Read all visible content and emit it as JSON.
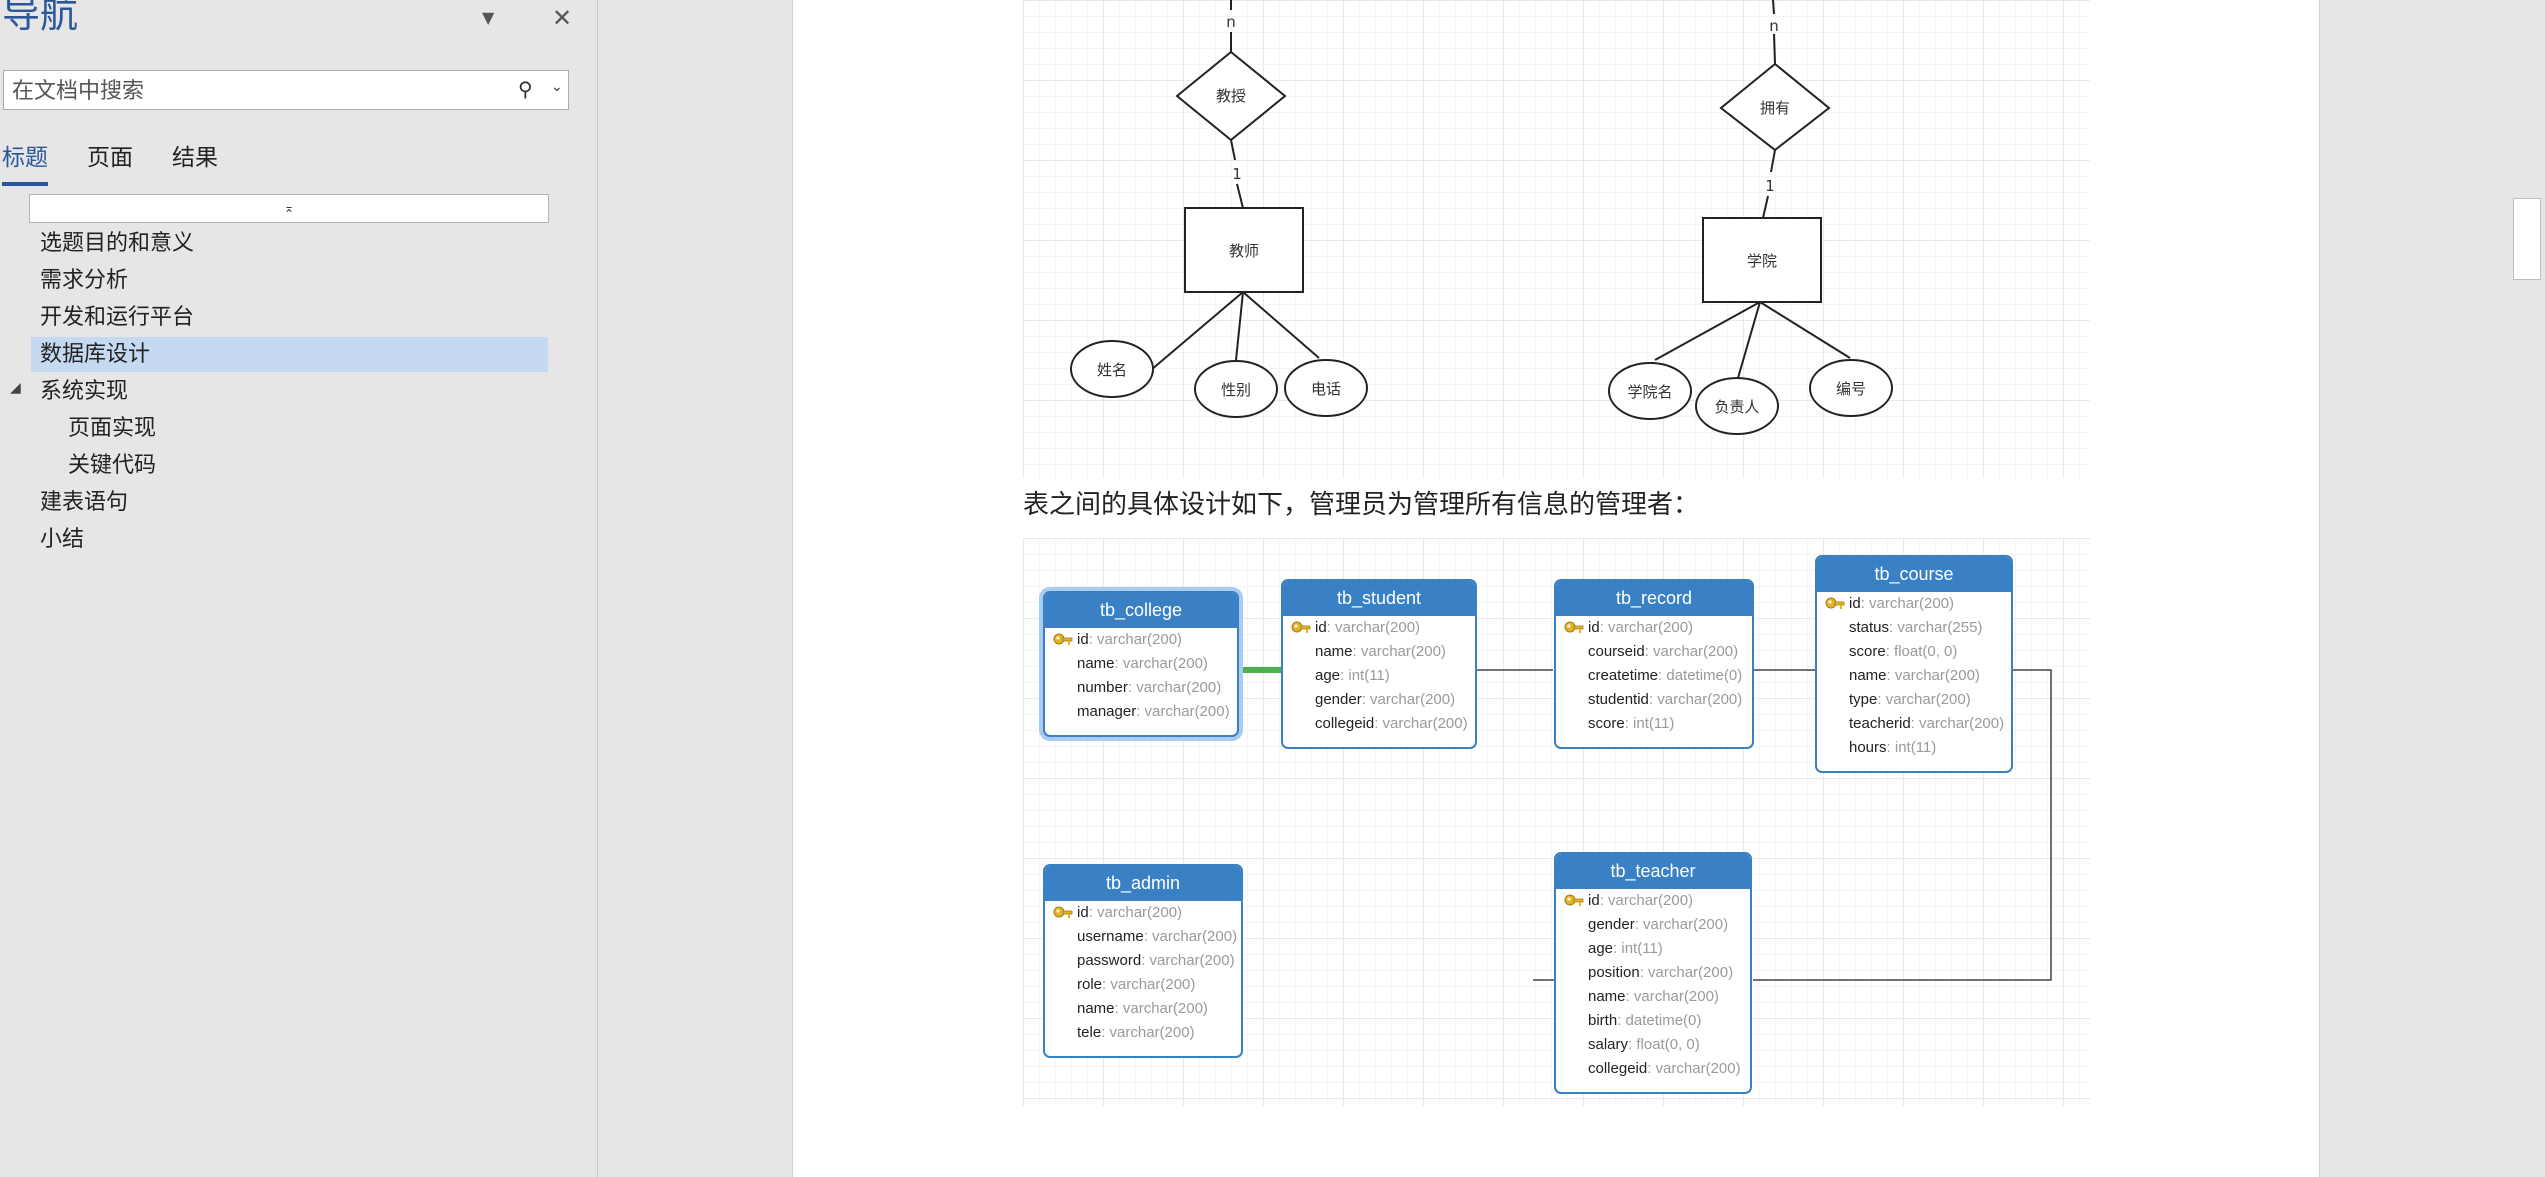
{
  "nav": {
    "title": "导航",
    "search_placeholder": "在文档中搜索",
    "tabs": [
      "标题",
      "页面",
      "结果"
    ],
    "collapse_glyph": "⌅",
    "headings": [
      {
        "label": "选题目的和意义",
        "level": 1,
        "selected": false
      },
      {
        "label": "需求分析",
        "level": 1,
        "selected": false
      },
      {
        "label": "开发和运行平台",
        "level": 1,
        "selected": false
      },
      {
        "label": "数据库设计",
        "level": 1,
        "selected": true
      },
      {
        "label": "系统实现",
        "level": 1,
        "selected": false,
        "expanded": true
      },
      {
        "label": "页面实现",
        "level": 2,
        "selected": false
      },
      {
        "label": "关键代码",
        "level": 2,
        "selected": false
      },
      {
        "label": "建表语句",
        "level": 1,
        "selected": false
      },
      {
        "label": "小结",
        "level": 1,
        "selected": false
      }
    ]
  },
  "er_diagram": {
    "left": {
      "rel_label": "教授",
      "card_top": "n",
      "card_bottom": "1",
      "entity": "教师",
      "attrs": [
        "姓名",
        "性别",
        "电话"
      ]
    },
    "right": {
      "rel_label": "拥有",
      "card_top": "n",
      "card_bottom": "1",
      "entity": "学院",
      "attrs": [
        "学院名",
        "负责人",
        "编号"
      ]
    }
  },
  "paragraph": "表之间的具体设计如下，管理员为管理所有信息的管理者：",
  "tables": [
    {
      "name": "tb_college",
      "selected": true,
      "fields": [
        {
          "name": "id",
          "type": "varchar(200)",
          "key": true
        },
        {
          "name": "name",
          "type": "varchar(200)"
        },
        {
          "name": "number",
          "type": "varchar(200)"
        },
        {
          "name": "manager",
          "type": "varchar(200)"
        }
      ]
    },
    {
      "name": "tb_student",
      "fields": [
        {
          "name": "id",
          "type": "varchar(200)",
          "key": true
        },
        {
          "name": "name",
          "type": "varchar(200)"
        },
        {
          "name": "age",
          "type": "int(11)"
        },
        {
          "name": "gender",
          "type": "varchar(200)"
        },
        {
          "name": "collegeid",
          "type": "varchar(200)"
        }
      ]
    },
    {
      "name": "tb_record",
      "fields": [
        {
          "name": "id",
          "type": "varchar(200)",
          "key": true
        },
        {
          "name": "courseid",
          "type": "varchar(200)"
        },
        {
          "name": "createtime",
          "type": "datetime(0)"
        },
        {
          "name": "studentid",
          "type": "varchar(200)"
        },
        {
          "name": "score",
          "type": "int(11)"
        }
      ]
    },
    {
      "name": "tb_course",
      "fields": [
        {
          "name": "id",
          "type": "varchar(200)",
          "key": true
        },
        {
          "name": "status",
          "type": "varchar(255)"
        },
        {
          "name": "score",
          "type": "float(0, 0)"
        },
        {
          "name": "name",
          "type": "varchar(200)"
        },
        {
          "name": "type",
          "type": "varchar(200)"
        },
        {
          "name": "teacherid",
          "type": "varchar(200)"
        },
        {
          "name": "hours",
          "type": "int(11)"
        }
      ]
    },
    {
      "name": "tb_admin",
      "fields": [
        {
          "name": "id",
          "type": "varchar(200)",
          "key": true
        },
        {
          "name": "username",
          "type": "varchar(200)"
        },
        {
          "name": "password",
          "type": "varchar(200)"
        },
        {
          "name": "role",
          "type": "varchar(200)"
        },
        {
          "name": "name",
          "type": "varchar(200)"
        },
        {
          "name": "tele",
          "type": "varchar(200)"
        }
      ]
    },
    {
      "name": "tb_teacher",
      "fields": [
        {
          "name": "id",
          "type": "varchar(200)",
          "key": true
        },
        {
          "name": "gender",
          "type": "varchar(200)"
        },
        {
          "name": "age",
          "type": "int(11)"
        },
        {
          "name": "position",
          "type": "varchar(200)"
        },
        {
          "name": "name",
          "type": "varchar(200)"
        },
        {
          "name": "birth",
          "type": "datetime(0)"
        },
        {
          "name": "salary",
          "type": "float(0, 0)"
        },
        {
          "name": "collegeid",
          "type": "varchar(200)"
        }
      ]
    }
  ],
  "colors": {
    "accent": "#2b579a",
    "table_header": "#3a80c4",
    "selection": "#c5d9f1",
    "fk_highlight": "#4caf50"
  }
}
